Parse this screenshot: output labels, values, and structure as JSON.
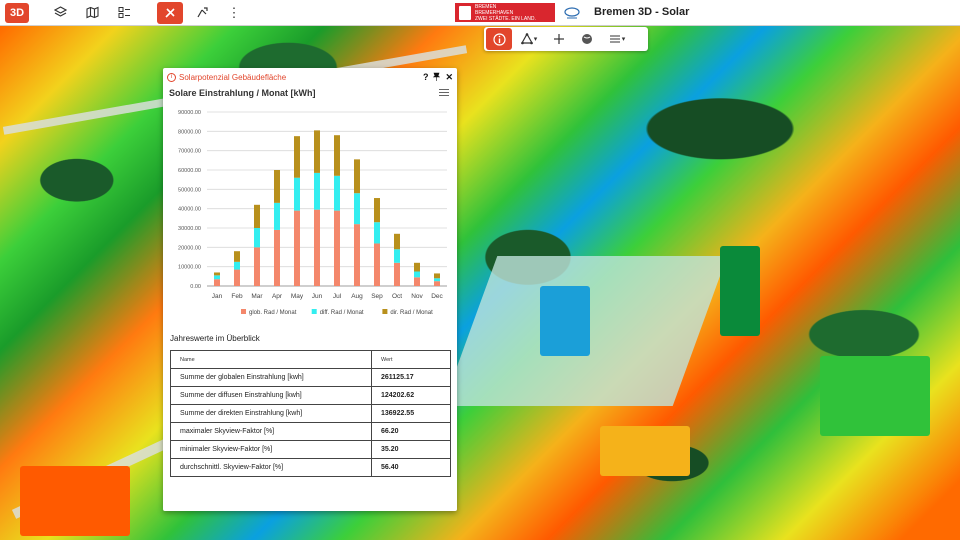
{
  "topbar": {
    "btn_3d": "3D",
    "icons": [
      "layers-icon",
      "map-icon",
      "legend-icon",
      "tools-icon",
      "measure-icon",
      "more-icon"
    ],
    "logo_lines": [
      "BREMEN",
      "BREMERHAVEN",
      "ZWEI STÄDTE. EIN LAND."
    ],
    "title": "Bremen 3D - Solar"
  },
  "maptools": [
    "info-icon",
    "point-icon",
    "measure-icon",
    "globe-icon",
    "tilt-icon"
  ],
  "panel": {
    "title": "Solarpotenzial Gebäudefläche",
    "chart_title": "Solare Einstrahlung / Monat [kWh]",
    "section_title": "Jahreswerte im Überblick",
    "table": {
      "headers": [
        "Name",
        "Wert"
      ],
      "rows": [
        [
          "Summe der globalen Einstrahlung [kwh]",
          "261125.17"
        ],
        [
          "Summe der diffusen Einstrahlung [kwh]",
          "124202.62"
        ],
        [
          "Summe der direkten Einstrahlung [kwh]",
          "136922.55"
        ],
        [
          "maximaler Skyview-Faktor [%]",
          "66.20"
        ],
        [
          "minimaler Skyview-Faktor [%]",
          "35.20"
        ],
        [
          "durchschnittl. Skyview-Faktor [%]",
          "56.40"
        ]
      ]
    }
  },
  "colors": {
    "accent": "#e2462c",
    "glob": "#f4876b",
    "diff": "#33eef0",
    "dir": "#b8901c"
  },
  "chart_data": {
    "type": "bar",
    "stacked": true,
    "categories": [
      "Jan",
      "Feb",
      "Mar",
      "Apr",
      "May",
      "Jun",
      "Jul",
      "Aug",
      "Sep",
      "Oct",
      "Nov",
      "Dec"
    ],
    "series": [
      {
        "name": "glob. Rad / Monat",
        "values": [
          3500,
          8500,
          20000,
          29000,
          39000,
          39500,
          39000,
          32000,
          22000,
          12000,
          4500,
          2500
        ]
      },
      {
        "name": "diff. Rad / Monat",
        "values": [
          2000,
          4000,
          10000,
          14000,
          17000,
          19000,
          18000,
          16000,
          11000,
          7000,
          3000,
          1500
        ]
      },
      {
        "name": "dir. Rad / Monat",
        "values": [
          1500,
          5500,
          12000,
          17000,
          21500,
          22000,
          21000,
          17500,
          12500,
          8000,
          4500,
          2500
        ]
      }
    ],
    "yticks": [
      "0.00",
      "10000.00",
      "20000.00",
      "30000.00",
      "40000.00",
      "50000.00",
      "60000.00",
      "70000.00",
      "80000.00",
      "90000.00"
    ],
    "ylim": [
      0,
      90000
    ],
    "legend_position": "bottom"
  }
}
